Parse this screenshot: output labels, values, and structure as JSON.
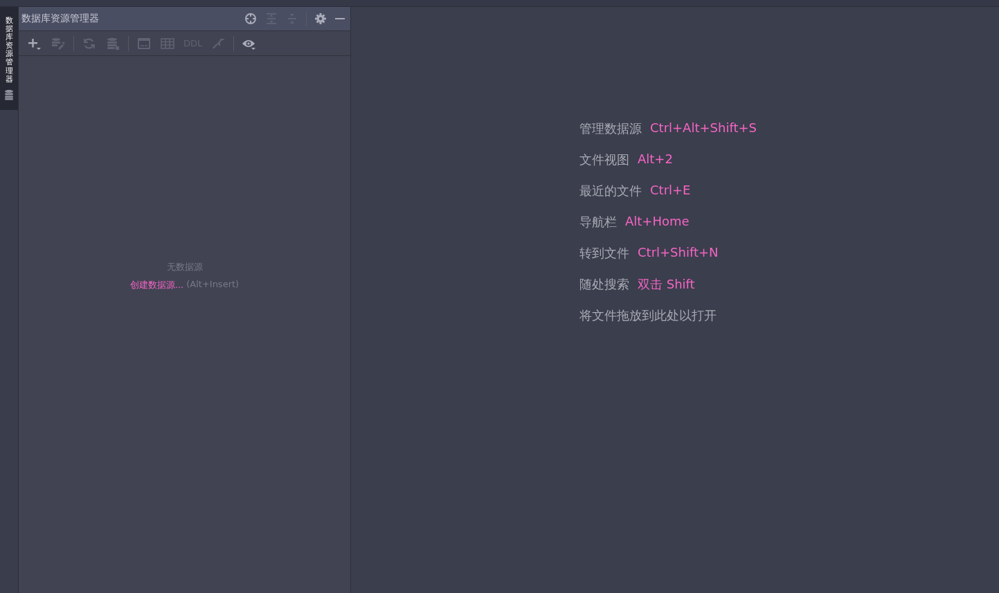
{
  "side_tab": {
    "label": "数据库资源管理器",
    "selected": true
  },
  "panel": {
    "title": "数据库资源管理器",
    "header_tools": [
      {
        "kind": "crosshair",
        "disabled": false
      },
      {
        "kind": "expand",
        "disabled": true
      },
      {
        "kind": "collapse",
        "disabled": true
      },
      {
        "kind": "sep"
      },
      {
        "kind": "gear",
        "disabled": false
      },
      {
        "kind": "minimize",
        "disabled": false
      }
    ],
    "toolbar": [
      {
        "kind": "plus",
        "disabled": false
      },
      {
        "kind": "wrench",
        "disabled": true
      },
      {
        "kind": "sep"
      },
      {
        "kind": "refresh",
        "disabled": true
      },
      {
        "kind": "db",
        "disabled": true
      },
      {
        "kind": "sep"
      },
      {
        "kind": "ql",
        "disabled": true
      },
      {
        "kind": "table",
        "disabled": true
      },
      {
        "kind": "text",
        "label": "DDL",
        "disabled": true
      },
      {
        "kind": "jump",
        "disabled": true
      },
      {
        "kind": "sep"
      },
      {
        "kind": "eye",
        "disabled": false
      }
    ],
    "empty_text": "无数据源",
    "create_link": "创建数据源...",
    "create_shortcut": "(Alt+Insert)"
  },
  "hints": [
    {
      "label": "管理数据源",
      "keys": "Ctrl+Alt+Shift+S"
    },
    {
      "label": "文件视图",
      "keys": "Alt+2"
    },
    {
      "label": "最近的文件",
      "keys": "Ctrl+E"
    },
    {
      "label": "导航栏",
      "keys": "Alt+Home"
    },
    {
      "label": "转到文件",
      "keys": "Ctrl+Shift+N"
    },
    {
      "label": "随处搜索",
      "keys": "双击 Shift"
    },
    {
      "label": "将文件拖放到此处以打开"
    }
  ]
}
